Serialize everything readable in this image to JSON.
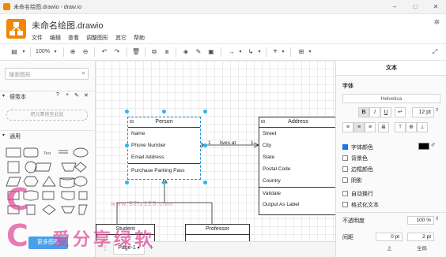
{
  "window": {
    "title": "未命名绘图.drawio - draw.io"
  },
  "header": {
    "doc_name": "未命名绘图.drawio",
    "menu": [
      "文件",
      "编辑",
      "查看",
      "调整图形",
      "其它",
      "帮助"
    ]
  },
  "toolbar": {
    "zoom": "100%"
  },
  "sidebar": {
    "search_placeholder": "搜索图形",
    "scratchpad_label": "便笺本",
    "scratchpad_drop": "把元素拖至此处",
    "general_label": "通用",
    "add_shapes_label": "更多图形"
  },
  "canvas": {
    "classes": [
      {
        "id": "person",
        "title": "Person",
        "rows": [
          "Name",
          "Phone Number",
          "Email Address"
        ],
        "methods": [
          "Purchase Parking Pass"
        ]
      },
      {
        "id": "address",
        "title": "Address",
        "rows": [
          "Street",
          "City",
          "State",
          "Postal Code",
          "Country"
        ],
        "methods": [
          "Validate",
          "Output As Label"
        ]
      },
      {
        "id": "student",
        "title": "Student"
      },
      {
        "id": "professor",
        "title": "Professor"
      }
    ],
    "edge": {
      "label": "lives at",
      "mult_left": "1",
      "mult_right": "1"
    }
  },
  "pages": {
    "current": "Page-1"
  },
  "panel": {
    "tab": "文本",
    "font_label": "字体",
    "font_name": "Helvetica",
    "font_size": "12 pt",
    "checkboxes": [
      {
        "label": "字体颜色",
        "checked": true
      },
      {
        "label": "背景色",
        "checked": false
      },
      {
        "label": "边框颜色",
        "checked": false
      },
      {
        "label": "阴影",
        "checked": false
      },
      {
        "label": "自动换行",
        "checked": false
      },
      {
        "label": "格式化文本",
        "checked": false
      }
    ],
    "opacity_label": "不透明度",
    "opacity": "100 %",
    "spacing_label": "间距",
    "spacing_top": "0 pt",
    "spacing_global": "2 pt",
    "spacing_top_label": "上",
    "spacing_global_label": "全局",
    "colors": {
      "font_color": "#000000",
      "accent": "#1a73e8"
    }
  },
  "watermark": {
    "text": "爱分享绿软",
    "url": "www.52lz123.com"
  }
}
